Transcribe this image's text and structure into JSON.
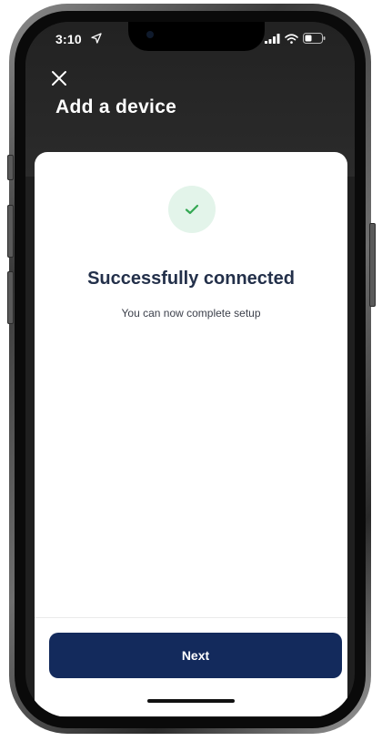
{
  "status_bar": {
    "time": "3:10",
    "location_icon": "location-arrow-icon",
    "signal_icon": "signal-bars-icon",
    "wifi_icon": "wifi-icon",
    "battery_icon": "battery-icon"
  },
  "header": {
    "close_icon": "close-icon",
    "title": "Add a device"
  },
  "content": {
    "success_icon": "checkmark-icon",
    "headline": "Successfully connected",
    "subtext": "You can now complete setup"
  },
  "footer": {
    "next_label": "Next"
  },
  "colors": {
    "header_bg": "#262626",
    "success_badge_bg": "#e3f4ea",
    "success_check": "#34a853",
    "headline": "#23304a",
    "primary_button": "#132a5c"
  }
}
